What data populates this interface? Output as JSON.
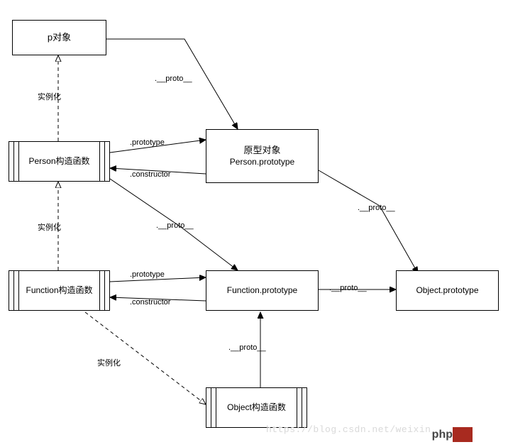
{
  "boxes": {
    "p_obj": "p对象",
    "person_ctor": "Person构造函数",
    "function_ctor": "Function构造函数",
    "object_ctor": "Object构造函数",
    "person_proto_title": "原型对象",
    "person_proto_sub": "Person.prototype",
    "function_proto": "Function.prototype",
    "object_proto": "Object.prototype"
  },
  "labels": {
    "instantiate": "实例化",
    "dunder_proto": ".__proto__",
    "prototype": ".prototype",
    "constructor": ".constructor"
  },
  "watermark": "https://blog.csdn.net/weixin_",
  "logo": {
    "left": "php",
    "right": ""
  }
}
